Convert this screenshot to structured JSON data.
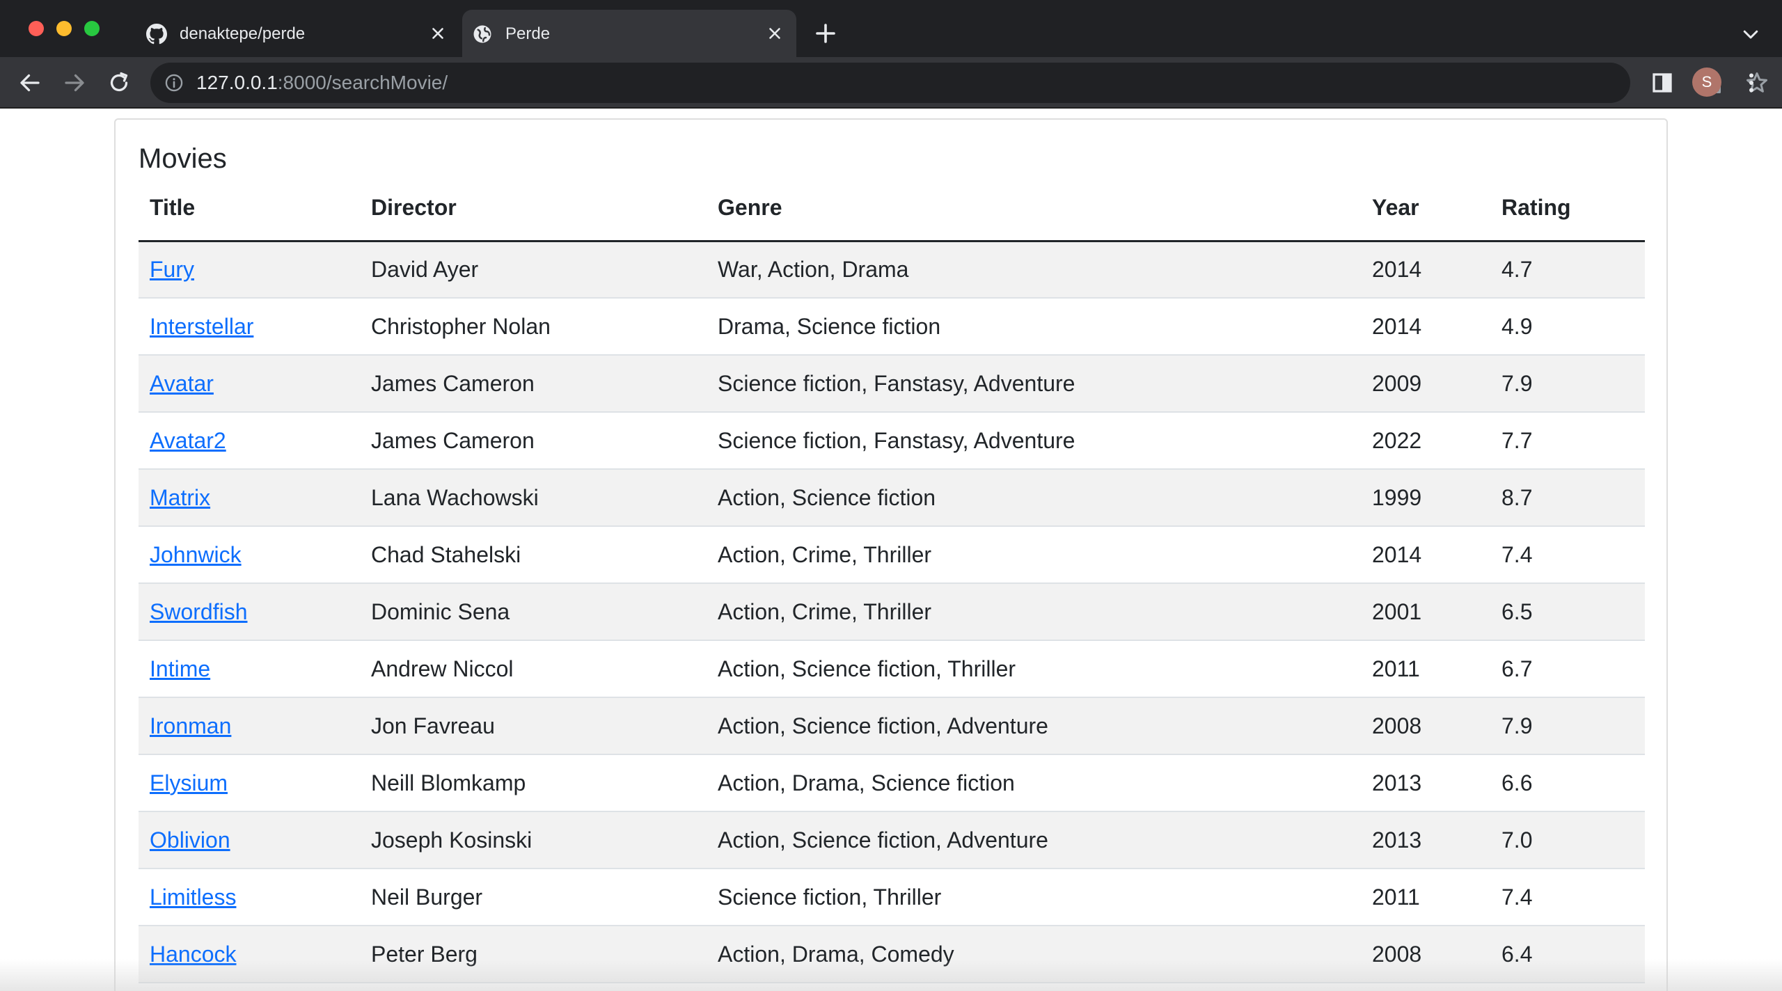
{
  "browser": {
    "tabs": [
      {
        "title": "denaktepe/perde",
        "favicon": "github-icon",
        "active": false
      },
      {
        "title": "Perde",
        "favicon": "globe-icon",
        "active": true
      }
    ],
    "url_host": "127.0.0.1",
    "url_rest": ":8000/searchMovie/",
    "profile_initial": "S"
  },
  "page": {
    "heading": "Movies",
    "columns": {
      "title": "Title",
      "director": "Director",
      "genre": "Genre",
      "year": "Year",
      "rating": "Rating"
    },
    "movies": [
      {
        "title": "Fury",
        "director": "David Ayer",
        "genre": "War, Action, Drama",
        "year": "2014",
        "rating": "4.7"
      },
      {
        "title": "Interstellar",
        "director": "Christopher Nolan",
        "genre": "Drama, Science fiction",
        "year": "2014",
        "rating": "4.9"
      },
      {
        "title": "Avatar",
        "director": "James Cameron",
        "genre": "Science fiction, Fanstasy, Adventure",
        "year": "2009",
        "rating": "7.9"
      },
      {
        "title": "Avatar2",
        "director": "James Cameron",
        "genre": "Science fiction, Fanstasy, Adventure",
        "year": "2022",
        "rating": "7.7"
      },
      {
        "title": "Matrix",
        "director": "Lana Wachowski",
        "genre": "Action, Science fiction",
        "year": "1999",
        "rating": "8.7"
      },
      {
        "title": "Johnwick",
        "director": "Chad Stahelski",
        "genre": "Action, Crime, Thriller",
        "year": "2014",
        "rating": "7.4"
      },
      {
        "title": "Swordfish",
        "director": "Dominic Sena",
        "genre": "Action, Crime, Thriller",
        "year": "2001",
        "rating": "6.5"
      },
      {
        "title": "Intime",
        "director": "Andrew Niccol",
        "genre": "Action, Science fiction, Thriller",
        "year": "2011",
        "rating": "6.7"
      },
      {
        "title": "Ironman",
        "director": "Jon Favreau",
        "genre": "Action, Science fiction, Adventure",
        "year": "2008",
        "rating": "7.9"
      },
      {
        "title": "Elysium",
        "director": "Neill Blomkamp",
        "genre": "Action, Drama, Science fiction",
        "year": "2013",
        "rating": "6.6"
      },
      {
        "title": "Oblivion",
        "director": "Joseph Kosinski",
        "genre": "Action, Science fiction, Adventure",
        "year": "2013",
        "rating": "7.0"
      },
      {
        "title": "Limitless",
        "director": "Neil Burger",
        "genre": "Science fiction, Thriller",
        "year": "2011",
        "rating": "7.4"
      },
      {
        "title": "Hancock",
        "director": "Peter Berg",
        "genre": "Action, Drama, Comedy",
        "year": "2008",
        "rating": "6.4"
      }
    ]
  },
  "colors": {
    "link": "#0d6efd",
    "row_stripe": "#f2f2f2",
    "chrome_dark": "#202124",
    "chrome_toolbar": "#35363a"
  }
}
